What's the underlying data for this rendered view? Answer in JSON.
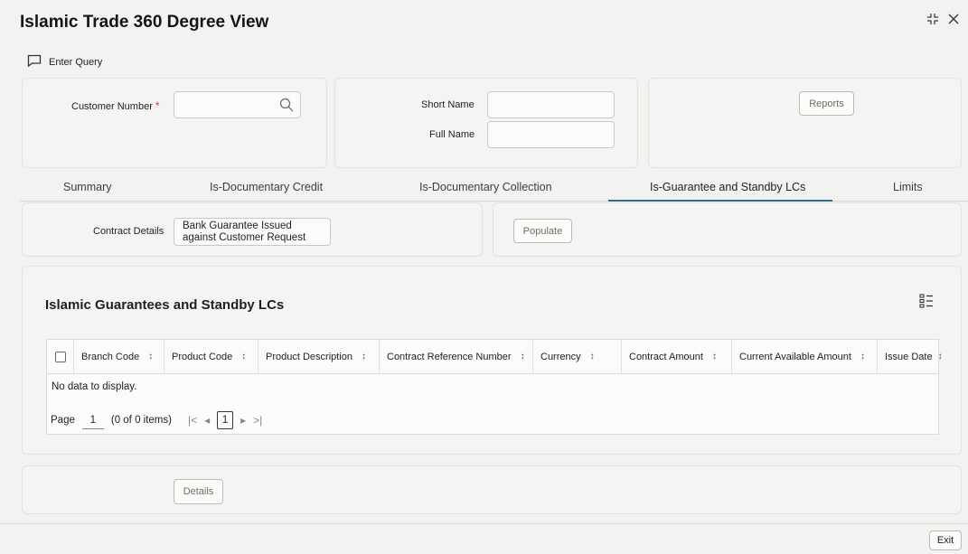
{
  "window": {
    "title": "Islamic Trade 360 Degree View"
  },
  "toolbar": {
    "enter_query_label": "Enter Query"
  },
  "header_form": {
    "customer_number_label": "Customer Number",
    "customer_number_value": "",
    "short_name_label": "Short Name",
    "short_name_value": "",
    "full_name_label": "Full Name",
    "full_name_value": "",
    "reports_label": "Reports"
  },
  "tabs": [
    {
      "label": "Summary"
    },
    {
      "label": "Is-Documentary Credit"
    },
    {
      "label": "Is-Documentary Collection"
    },
    {
      "label": "Is-Guarantee and Standby LCs"
    },
    {
      "label": "Limits"
    }
  ],
  "active_tab": "Is-Guarantee and Standby LCs",
  "contract": {
    "label": "Contract Details",
    "value_line1": "Bank Guarantee Issued",
    "value_line2": "against Customer Request",
    "populate_label": "Populate"
  },
  "grid": {
    "title": "Islamic Guarantees and Standby LCs",
    "columns": [
      {
        "label": "Branch Code"
      },
      {
        "label": "Product Code"
      },
      {
        "label": "Product Description"
      },
      {
        "label": "Contract Reference Number"
      },
      {
        "label": "Currency"
      },
      {
        "label": "Contract Amount"
      },
      {
        "label": "Current Available Amount"
      },
      {
        "label": "Issue Date"
      }
    ],
    "empty_text": "No data to display.",
    "pager": {
      "page_label": "Page",
      "page_value": "1",
      "items_text": "(0 of 0 items)",
      "current_page": "1"
    }
  },
  "details_label": "Details",
  "exit_label": "Exit",
  "colors": {
    "accent": "#2b6f87",
    "required": "#c74634"
  }
}
